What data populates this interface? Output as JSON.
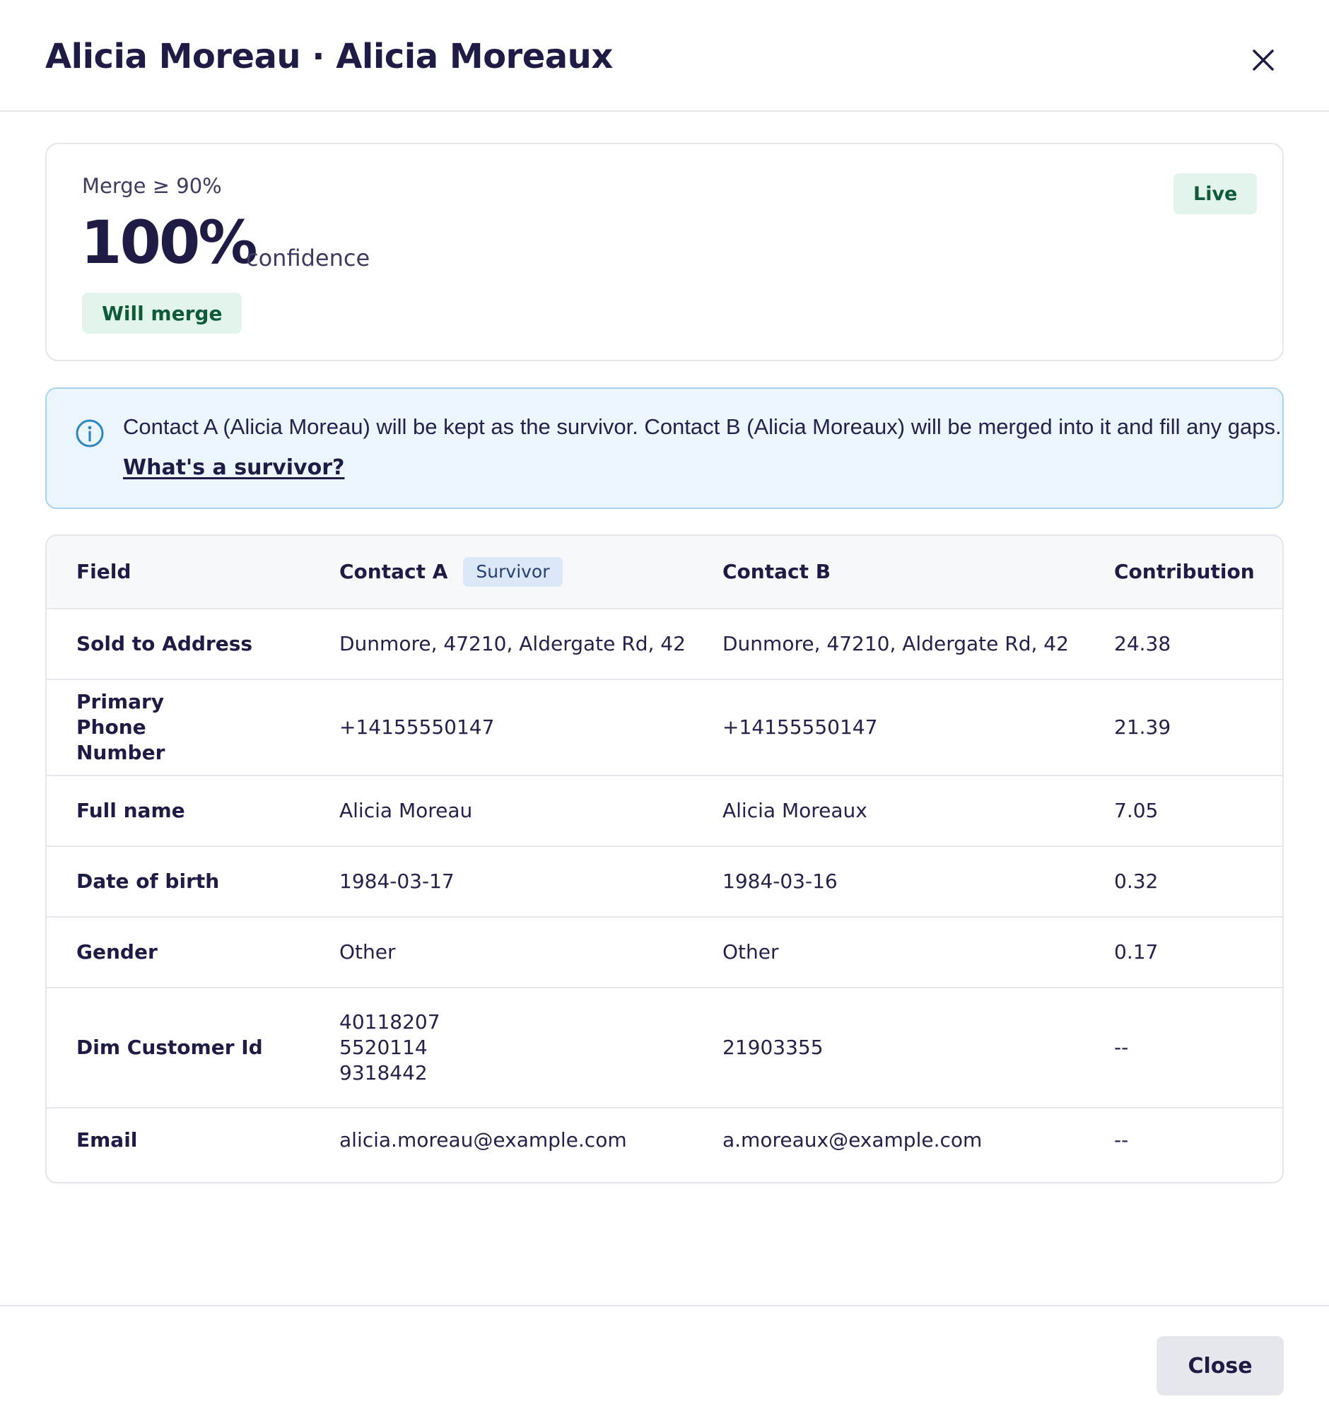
{
  "dialog": {
    "title": "Alicia Moreau · Alicia Moreaux",
    "close_icon": "close-icon"
  },
  "score": {
    "threshold_label": "Merge ≥ 90%",
    "value": "100%",
    "unit": "confidence",
    "status": "Will merge",
    "mode": "Live"
  },
  "info": {
    "icon": "info-icon",
    "message": "Contact A (Alicia Moreau) will be kept as the survivor. Contact B (Alicia Moreaux) will be merged into it and fill any gaps.",
    "link": "What's a survivor?"
  },
  "table": {
    "headers": {
      "field": "Field",
      "contact_a": "Contact A",
      "survivor_badge": "Survivor",
      "contact_b": "Contact B",
      "contribution": "Contribution"
    },
    "rows": [
      {
        "field": "Sold to Address",
        "a": [
          "Dunmore, 47210, Aldergate Rd, 42"
        ],
        "b": [
          "Dunmore, 47210, Aldergate Rd, 42"
        ],
        "contribution": "24.38"
      },
      {
        "field": "Primary Phone Number",
        "a": [
          "+14155550147"
        ],
        "b": [
          "+14155550147"
        ],
        "contribution": "21.39"
      },
      {
        "field": "Full name",
        "a": [
          "Alicia Moreau"
        ],
        "b": [
          "Alicia Moreaux"
        ],
        "contribution": "7.05"
      },
      {
        "field": "Date of birth",
        "a": [
          "1984-03-17"
        ],
        "b": [
          "1984-03-16"
        ],
        "contribution": "0.32"
      },
      {
        "field": "Gender",
        "a": [
          "Other"
        ],
        "b": [
          "Other"
        ],
        "contribution": "0.17"
      },
      {
        "field": "Dim Customer Id",
        "a": [
          "40118207",
          "5520114",
          "9318442"
        ],
        "b": [
          "21903355"
        ],
        "contribution": "--"
      },
      {
        "field": "Email",
        "a": [
          "alicia.moreau@example.com"
        ],
        "b": [
          "a.moreaux@example.com"
        ],
        "contribution": "--"
      }
    ]
  },
  "footer": {
    "close_label": "Close"
  },
  "colors": {
    "accent_green_bg": "#e3f4ec",
    "accent_green_text": "#0f5a38",
    "info_bg": "#eaf5fd",
    "info_border": "#a8d4ef",
    "survivor_bg": "#dce7f7"
  }
}
